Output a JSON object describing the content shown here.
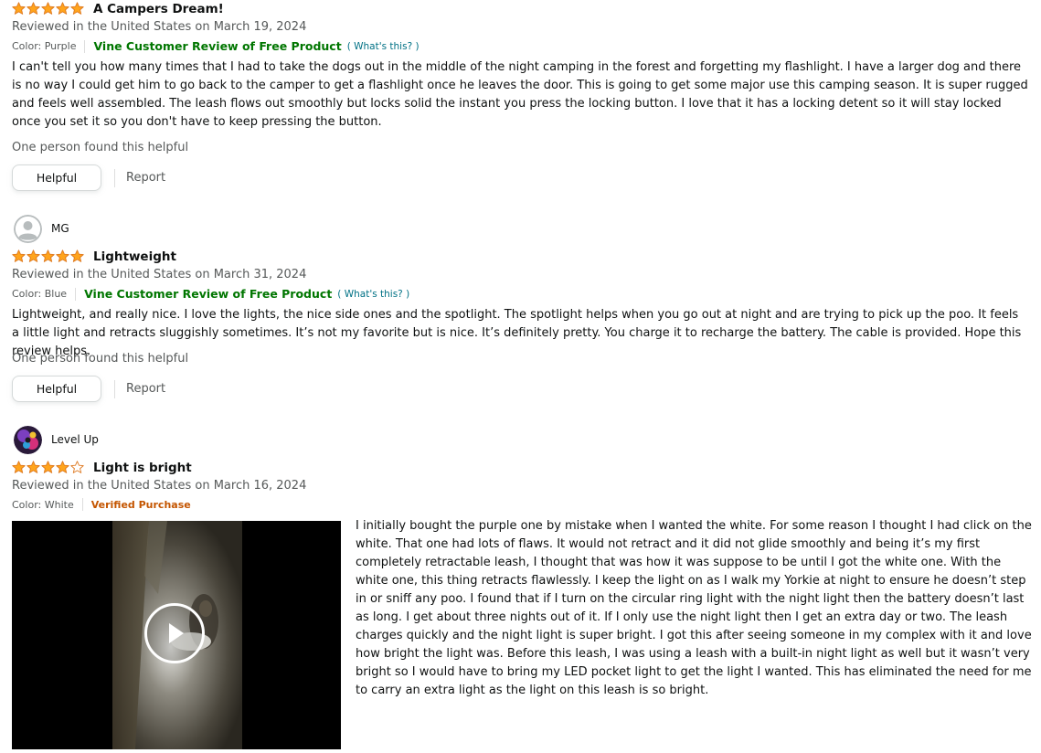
{
  "reviews": [
    {
      "rating": 5,
      "title": "A Campers Dream!",
      "date_line": "Reviewed in the United States on March 19, 2024",
      "color": "Color: Purple",
      "badge": "Vine Customer Review of Free Product",
      "whats_this": "( What's this? )",
      "body": "I can't tell you how many times that I had to take the dogs out in the middle of the night camping in the forest and forgetting my flashlight. I have a larger dog and there is no way I could get him to go back to the camper to get a flashlight once he leaves the door. This is going to get some major use this camping season. It is super rugged and feels well assembled. The leash flows out smoothly but locks solid the instant you press the locking button. I love that it has a locking detent so it will stay locked once you set it so you don't have to keep pressing the button.",
      "helpful_count": "One person found this helpful",
      "helpful_label": "Helpful",
      "report_label": "Report"
    },
    {
      "reviewer": "MG",
      "avatar_icon": "default-user-icon",
      "rating": 5,
      "title": "Lightweight",
      "date_line": "Reviewed in the United States on March 31, 2024",
      "color": "Color: Blue",
      "badge": "Vine Customer Review of Free Product",
      "whats_this": "( What's this? )",
      "body": "Lightweight, and really nice. I love the lights, the nice side ones and the spotlight. The spotlight helps when you go out at night and are trying to pick up the poo. It feels a little light and retracts sluggishly sometimes. It’s not my favorite but is nice. It’s definitely pretty. You charge it to recharge the battery. The cable is provided. Hope this review helps.",
      "helpful_count": "One person found this helpful",
      "helpful_label": "Helpful",
      "report_label": "Report"
    },
    {
      "reviewer": "Level Up",
      "avatar_icon": "colorful-avatar",
      "rating": 4,
      "title": "Light is bright",
      "date_line": "Reviewed in the United States on March 16, 2024",
      "color": "Color: White",
      "badge": "Verified Purchase",
      "media": "video-thumbnail",
      "body": "I initially bought the purple one by mistake when I wanted the white. For some reason I thought I had click on the white. That one had lots of flaws. It would not retract and it did not glide smoothly and being it’s my first completely retractable leash, I thought that was how it was suppose to be until I got the white one. With the white one, this thing retracts flawlessly. I keep the light on as I walk my Yorkie at night to ensure he doesn’t step in or sniff any poo. I found that if I turn on the circular ring light with the night light then the battery doesn’t last as long. I get about three nights out of it. If I only use the night light then I get an extra day or two. The leash charges quickly and the night light is super bright. I got this after seeing someone in my complex with it and love how bright the light was. Before this leash, I was using a leash with a built-in night light as well but it wasn’t very bright so I would have to bring my LED pocket light to get the light I wanted. This has eliminated the need for me to carry an extra light as the light on this leash is so bright."
    }
  ],
  "colors": {
    "star": "#ffa41c",
    "vine": "#007600",
    "verified": "#c45500",
    "link": "#007185"
  }
}
